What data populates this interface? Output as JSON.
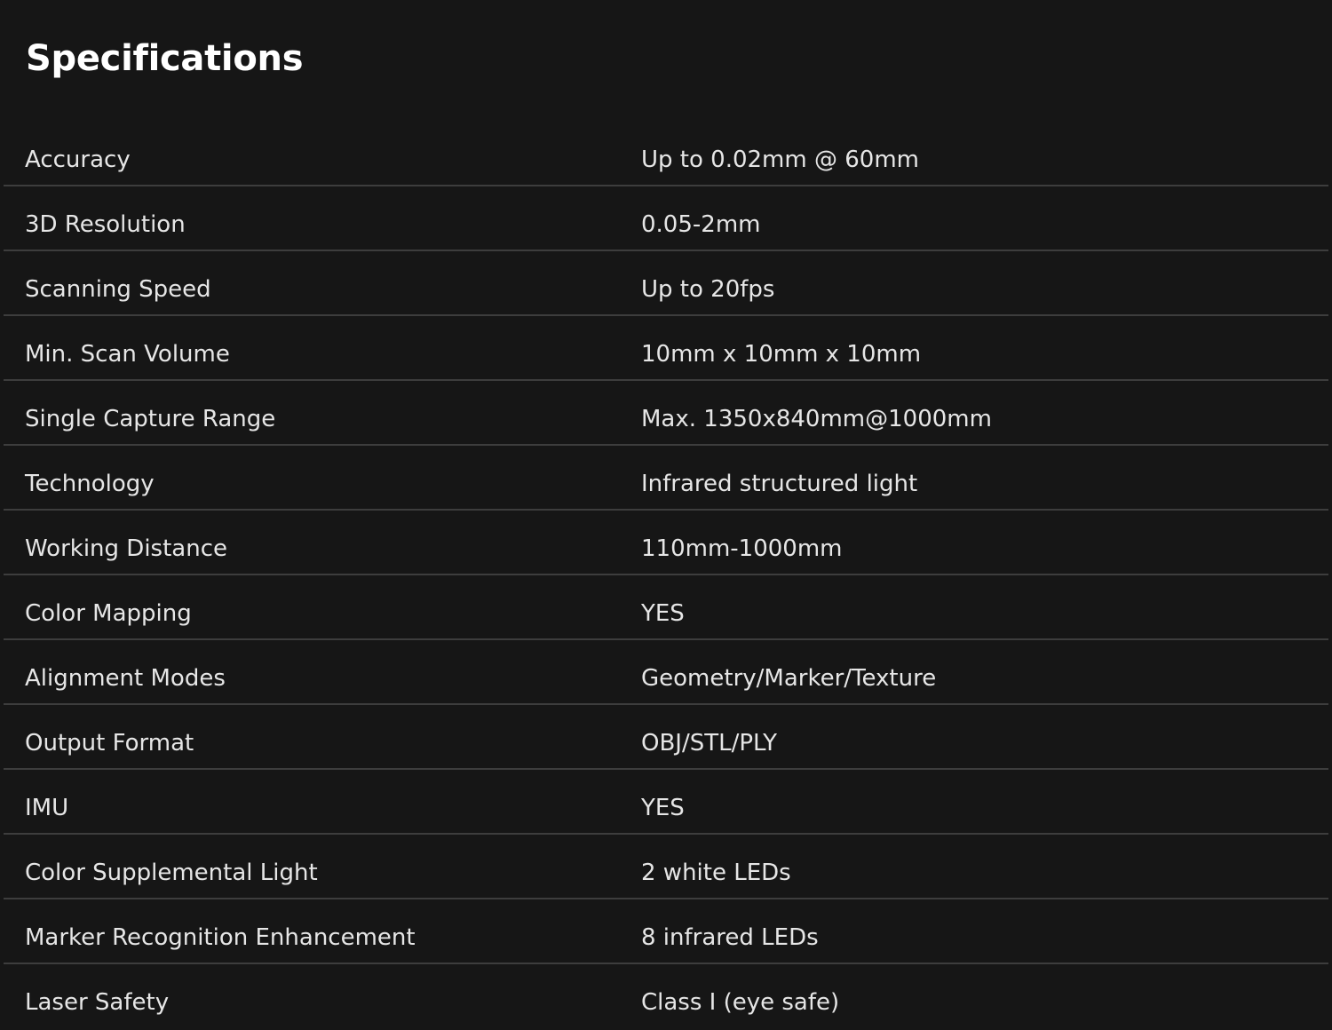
{
  "page": {
    "title": "Specifications"
  },
  "colors": {
    "background": "#161616",
    "text": "#e6e6e6",
    "divider": "#3d3d3d"
  },
  "specs": [
    {
      "label": "Accuracy",
      "value": "Up to 0.02mm @ 60mm"
    },
    {
      "label": "3D Resolution",
      "value": "0.05-2mm"
    },
    {
      "label": "Scanning Speed",
      "value": "Up to 20fps"
    },
    {
      "label": "Min. Scan Volume",
      "value": "10mm x 10mm x 10mm"
    },
    {
      "label": "Single Capture Range",
      "value": "Max. 1350x840mm@1000mm"
    },
    {
      "label": "Technology",
      "value": "Infrared structured light"
    },
    {
      "label": "Working Distance",
      "value": "110mm-1000mm"
    },
    {
      "label": "Color Mapping",
      "value": "YES"
    },
    {
      "label": "Alignment Modes",
      "value": "Geometry/Marker/Texture"
    },
    {
      "label": "Output Format",
      "value": "OBJ/STL/PLY"
    },
    {
      "label": "IMU",
      "value": "YES"
    },
    {
      "label": "Color Supplemental Light",
      "value": "2 white LEDs"
    },
    {
      "label": "Marker Recognition Enhancement",
      "value": "8 infrared LEDs"
    },
    {
      "label": "Laser Safety",
      "value": "Class I (eye safe)"
    }
  ]
}
